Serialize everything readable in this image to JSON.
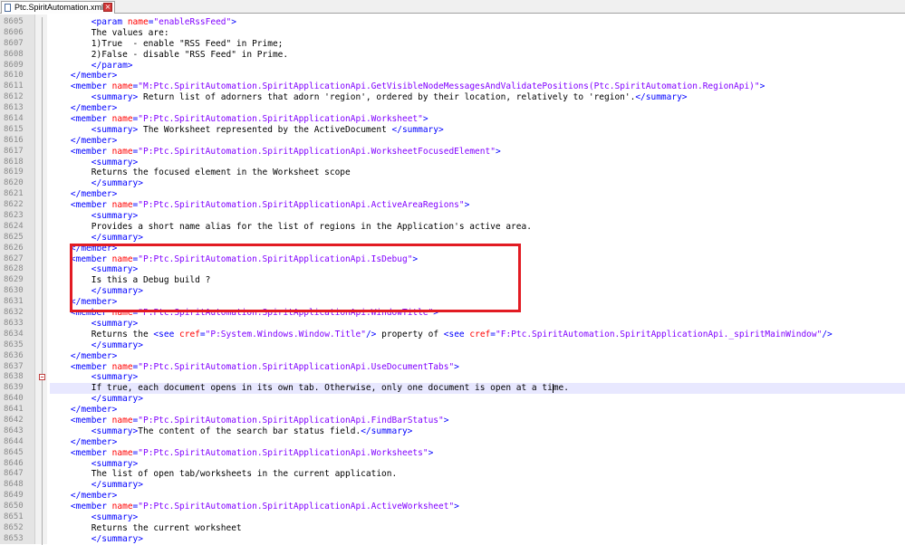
{
  "tab": {
    "title": "Ptc.SpiritAutomation.xml",
    "close_glyph": "×"
  },
  "colors": {
    "tag": "#0000ff",
    "attr": "#ff0000",
    "value": "#8000ff",
    "highlight_box": "#e21b23",
    "current_line": "#e8e8ff"
  },
  "lines": [
    {
      "num": "8605",
      "indent": 4,
      "tokens": [
        [
          "t",
          "<param "
        ],
        [
          "a",
          "name"
        ],
        [
          "t",
          "="
        ],
        [
          "v",
          "\"enableRssFeed\""
        ],
        [
          "t",
          ">"
        ]
      ]
    },
    {
      "num": "8606",
      "indent": 4,
      "tokens": [
        [
          "x",
          "The values are:"
        ]
      ]
    },
    {
      "num": "8607",
      "indent": 4,
      "tokens": [
        [
          "x",
          "1)True  - enable \"RSS Feed\" in Prime;"
        ]
      ]
    },
    {
      "num": "8608",
      "indent": 4,
      "tokens": [
        [
          "x",
          "2)False - disable \"RSS Feed\" in Prime."
        ]
      ]
    },
    {
      "num": "8609",
      "indent": 4,
      "tokens": [
        [
          "t",
          "</param>"
        ]
      ]
    },
    {
      "num": "8610",
      "indent": 2,
      "tokens": [
        [
          "t",
          "</member>"
        ]
      ]
    },
    {
      "num": "8611",
      "indent": 2,
      "tokens": [
        [
          "t",
          "<member "
        ],
        [
          "a",
          "name"
        ],
        [
          "t",
          "="
        ],
        [
          "v",
          "\"M:Ptc.SpiritAutomation.SpiritApplicationApi.GetVisibleNodeMessagesAndValidatePositions(Ptc.SpiritAutomation.RegionApi)\""
        ],
        [
          "t",
          ">"
        ]
      ]
    },
    {
      "num": "8612",
      "indent": 4,
      "tokens": [
        [
          "t",
          "<summary>"
        ],
        [
          "x",
          " Return list of adorners that adorn 'region', ordered by their location, relatively to 'region'."
        ],
        [
          "t",
          "</summary>"
        ]
      ]
    },
    {
      "num": "8613",
      "indent": 2,
      "tokens": [
        [
          "t",
          "</member>"
        ]
      ]
    },
    {
      "num": "8614",
      "indent": 2,
      "tokens": [
        [
          "t",
          "<member "
        ],
        [
          "a",
          "name"
        ],
        [
          "t",
          "="
        ],
        [
          "v",
          "\"P:Ptc.SpiritAutomation.SpiritApplicationApi.Worksheet\""
        ],
        [
          "t",
          ">"
        ]
      ]
    },
    {
      "num": "8615",
      "indent": 4,
      "tokens": [
        [
          "t",
          "<summary>"
        ],
        [
          "x",
          " The Worksheet represented by the ActiveDocument "
        ],
        [
          "t",
          "</summary>"
        ]
      ]
    },
    {
      "num": "8616",
      "indent": 2,
      "tokens": [
        [
          "t",
          "</member>"
        ]
      ]
    },
    {
      "num": "8617",
      "indent": 2,
      "tokens": [
        [
          "t",
          "<member "
        ],
        [
          "a",
          "name"
        ],
        [
          "t",
          "="
        ],
        [
          "v",
          "\"P:Ptc.SpiritAutomation.SpiritApplicationApi.WorksheetFocusedElement\""
        ],
        [
          "t",
          ">"
        ]
      ]
    },
    {
      "num": "8618",
      "indent": 4,
      "tokens": [
        [
          "t",
          "<summary>"
        ]
      ]
    },
    {
      "num": "8619",
      "indent": 4,
      "tokens": [
        [
          "x",
          "Returns the focused element in the Worksheet scope"
        ]
      ]
    },
    {
      "num": "8620",
      "indent": 4,
      "tokens": [
        [
          "t",
          "</summary>"
        ]
      ]
    },
    {
      "num": "8621",
      "indent": 2,
      "tokens": [
        [
          "t",
          "</member>"
        ]
      ]
    },
    {
      "num": "8622",
      "indent": 2,
      "tokens": [
        [
          "t",
          "<member "
        ],
        [
          "a",
          "name"
        ],
        [
          "t",
          "="
        ],
        [
          "v",
          "\"P:Ptc.SpiritAutomation.SpiritApplicationApi.ActiveAreaRegions\""
        ],
        [
          "t",
          ">"
        ]
      ]
    },
    {
      "num": "8623",
      "indent": 4,
      "tokens": [
        [
          "t",
          "<summary>"
        ]
      ]
    },
    {
      "num": "8624",
      "indent": 4,
      "tokens": [
        [
          "x",
          "Provides a short name alias for the list of regions in the Application's active area."
        ]
      ]
    },
    {
      "num": "8625",
      "indent": 4,
      "tokens": [
        [
          "t",
          "</summary>"
        ]
      ]
    },
    {
      "num": "8626",
      "indent": 2,
      "tokens": [
        [
          "t",
          "</member>"
        ]
      ]
    },
    {
      "num": "8627",
      "indent": 2,
      "tokens": [
        [
          "t",
          "<member "
        ],
        [
          "a",
          "name"
        ],
        [
          "t",
          "="
        ],
        [
          "v",
          "\"P:Ptc.SpiritAutomation.SpiritApplicationApi.IsDebug\""
        ],
        [
          "t",
          ">"
        ]
      ]
    },
    {
      "num": "8628",
      "indent": 4,
      "tokens": [
        [
          "t",
          "<summary>"
        ]
      ]
    },
    {
      "num": "8629",
      "indent": 4,
      "tokens": [
        [
          "x",
          "Is this a Debug build ?"
        ]
      ]
    },
    {
      "num": "8630",
      "indent": 4,
      "tokens": [
        [
          "t",
          "</summary>"
        ]
      ]
    },
    {
      "num": "8631",
      "indent": 2,
      "tokens": [
        [
          "t",
          "</member>"
        ]
      ]
    },
    {
      "num": "8632",
      "indent": 2,
      "tokens": [
        [
          "t",
          "<member "
        ],
        [
          "a",
          "name"
        ],
        [
          "t",
          "="
        ],
        [
          "v",
          "\"P:Ptc.SpiritAutomation.SpiritApplicationApi.WindowTitle\""
        ],
        [
          "t",
          ">"
        ]
      ]
    },
    {
      "num": "8633",
      "indent": 4,
      "tokens": [
        [
          "t",
          "<summary>"
        ]
      ]
    },
    {
      "num": "8634",
      "indent": 4,
      "tokens": [
        [
          "x",
          "Returns the "
        ],
        [
          "t",
          "<see "
        ],
        [
          "a",
          "cref"
        ],
        [
          "t",
          "="
        ],
        [
          "v",
          "\"P:System.Windows.Window.Title\""
        ],
        [
          "t",
          "/>"
        ],
        [
          "x",
          " property of "
        ],
        [
          "t",
          "<see "
        ],
        [
          "a",
          "cref"
        ],
        [
          "t",
          "="
        ],
        [
          "v",
          "\"F:Ptc.SpiritAutomation.SpiritApplicationApi._spiritMainWindow\""
        ],
        [
          "t",
          "/>"
        ]
      ]
    },
    {
      "num": "8635",
      "indent": 4,
      "tokens": [
        [
          "t",
          "</summary>"
        ]
      ]
    },
    {
      "num": "8636",
      "indent": 2,
      "tokens": [
        [
          "t",
          "</member>"
        ]
      ]
    },
    {
      "num": "8637",
      "indent": 2,
      "tokens": [
        [
          "t",
          "<member "
        ],
        [
          "a",
          "name"
        ],
        [
          "t",
          "="
        ],
        [
          "v",
          "\"P:Ptc.SpiritAutomation.SpiritApplicationApi.UseDocumentTabs\""
        ],
        [
          "t",
          ">"
        ]
      ]
    },
    {
      "num": "8638",
      "indent": 4,
      "fold": true,
      "tokens": [
        [
          "t",
          "<summary>"
        ]
      ]
    },
    {
      "num": "8639",
      "indent": 4,
      "current": true,
      "tokens": [
        [
          "x",
          "If true, each document opens in its own tab. Otherwise, only one document is open at a ti"
        ],
        [
          "caret",
          ""
        ],
        [
          "x",
          "me."
        ]
      ]
    },
    {
      "num": "8640",
      "indent": 4,
      "tokens": [
        [
          "t",
          "</summary>"
        ]
      ]
    },
    {
      "num": "8641",
      "indent": 2,
      "tokens": [
        [
          "t",
          "</member>"
        ]
      ]
    },
    {
      "num": "8642",
      "indent": 2,
      "tokens": [
        [
          "t",
          "<member "
        ],
        [
          "a",
          "name"
        ],
        [
          "t",
          "="
        ],
        [
          "v",
          "\"P:Ptc.SpiritAutomation.SpiritApplicationApi.FindBarStatus\""
        ],
        [
          "t",
          ">"
        ]
      ]
    },
    {
      "num": "8643",
      "indent": 4,
      "tokens": [
        [
          "t",
          "<summary>"
        ],
        [
          "x",
          "The content of the search bar status field."
        ],
        [
          "t",
          "</summary>"
        ]
      ]
    },
    {
      "num": "8644",
      "indent": 2,
      "tokens": [
        [
          "t",
          "</member>"
        ]
      ]
    },
    {
      "num": "8645",
      "indent": 2,
      "tokens": [
        [
          "t",
          "<member "
        ],
        [
          "a",
          "name"
        ],
        [
          "t",
          "="
        ],
        [
          "v",
          "\"P:Ptc.SpiritAutomation.SpiritApplicationApi.Worksheets\""
        ],
        [
          "t",
          ">"
        ]
      ]
    },
    {
      "num": "8646",
      "indent": 4,
      "tokens": [
        [
          "t",
          "<summary>"
        ]
      ]
    },
    {
      "num": "8647",
      "indent": 4,
      "tokens": [
        [
          "x",
          "The list of open tab/worksheets in the current application."
        ]
      ]
    },
    {
      "num": "8648",
      "indent": 4,
      "tokens": [
        [
          "t",
          "</summary>"
        ]
      ]
    },
    {
      "num": "8649",
      "indent": 2,
      "tokens": [
        [
          "t",
          "</member>"
        ]
      ]
    },
    {
      "num": "8650",
      "indent": 2,
      "tokens": [
        [
          "t",
          "<member "
        ],
        [
          "a",
          "name"
        ],
        [
          "t",
          "="
        ],
        [
          "v",
          "\"P:Ptc.SpiritAutomation.SpiritApplicationApi.ActiveWorksheet\""
        ],
        [
          "t",
          ">"
        ]
      ]
    },
    {
      "num": "8651",
      "indent": 4,
      "tokens": [
        [
          "t",
          "<summary>"
        ]
      ]
    },
    {
      "num": "8652",
      "indent": 4,
      "tokens": [
        [
          "x",
          "Returns the current worksheet"
        ]
      ]
    },
    {
      "num": "8653",
      "indent": 4,
      "tokens": [
        [
          "t",
          "</summary>"
        ]
      ]
    }
  ]
}
